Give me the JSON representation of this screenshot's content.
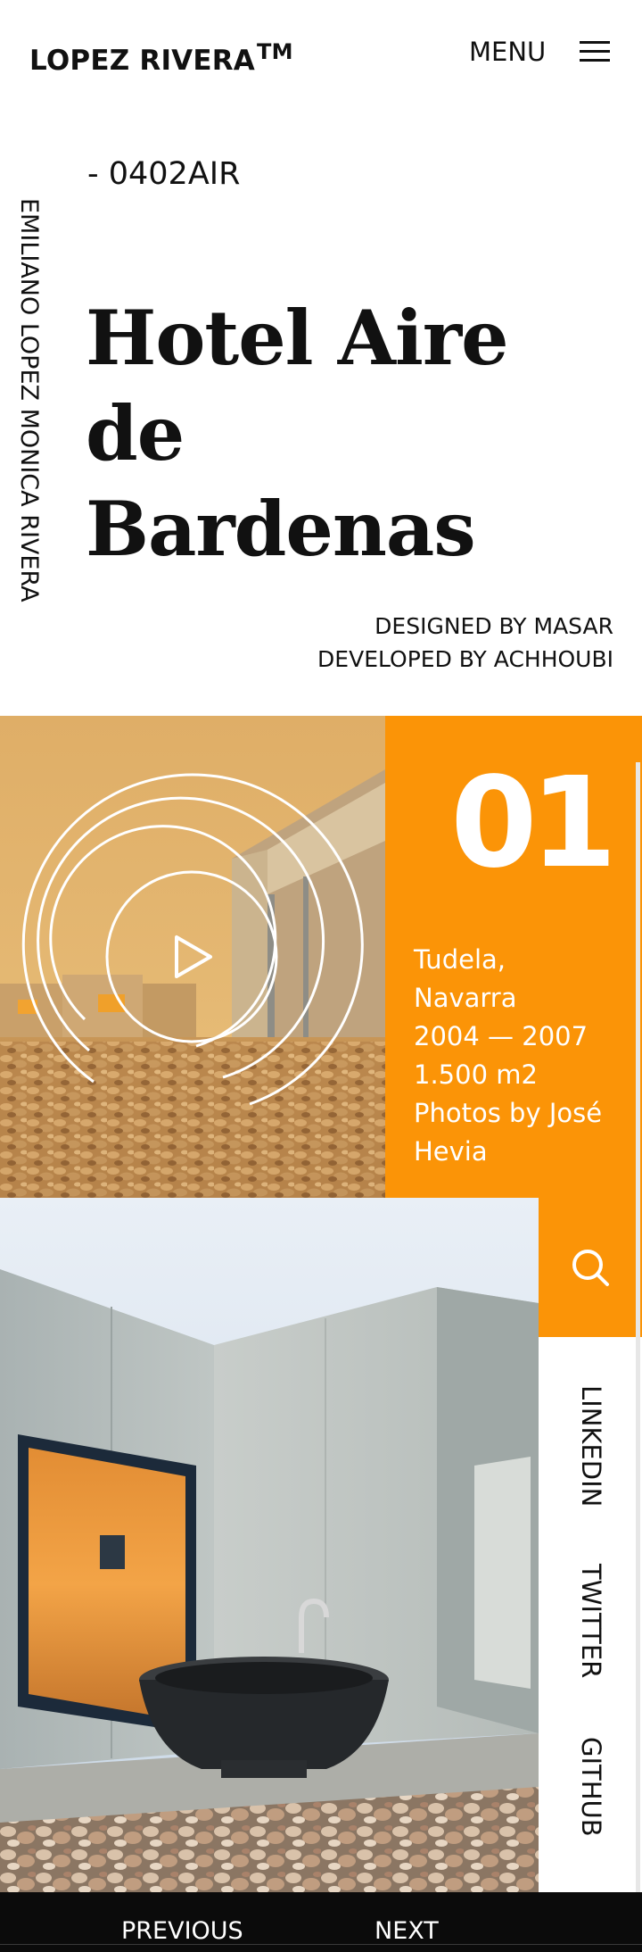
{
  "header": {
    "logo": "LOPEZ RIVERA",
    "logo_mark": "TM",
    "menu_label": "MENU",
    "menu_icon": "hamburger-icon"
  },
  "side_name": "EMILIANO LOPEZ MONICA RIVERA",
  "project": {
    "code": "- 0402AIR",
    "title_line1": "Hotel Aire de",
    "title_line2": "Bardenas",
    "designed_by": "DESIGNED BY MASAR",
    "developed_by": "DEVELOPED BY ACHHOUBI"
  },
  "info": {
    "number": "01",
    "location_city": "Tudela,",
    "location_region": "Navarra",
    "years": "2004 — 2007",
    "area": "1.500 m2",
    "photos_line1": "Photos by José",
    "photos_line2": "Hevia"
  },
  "hero": {
    "play_icon": "play-icon"
  },
  "social": {
    "search_icon": "search-icon",
    "links": [
      "LINKEDIN",
      "TWITTER",
      "GITHUB"
    ]
  },
  "footer": {
    "previous_label": "PREVIOUS",
    "next_label": "NEXT"
  },
  "colors": {
    "accent": "#fb9407",
    "text": "#111111",
    "footer_bg": "#0b0b0b"
  }
}
